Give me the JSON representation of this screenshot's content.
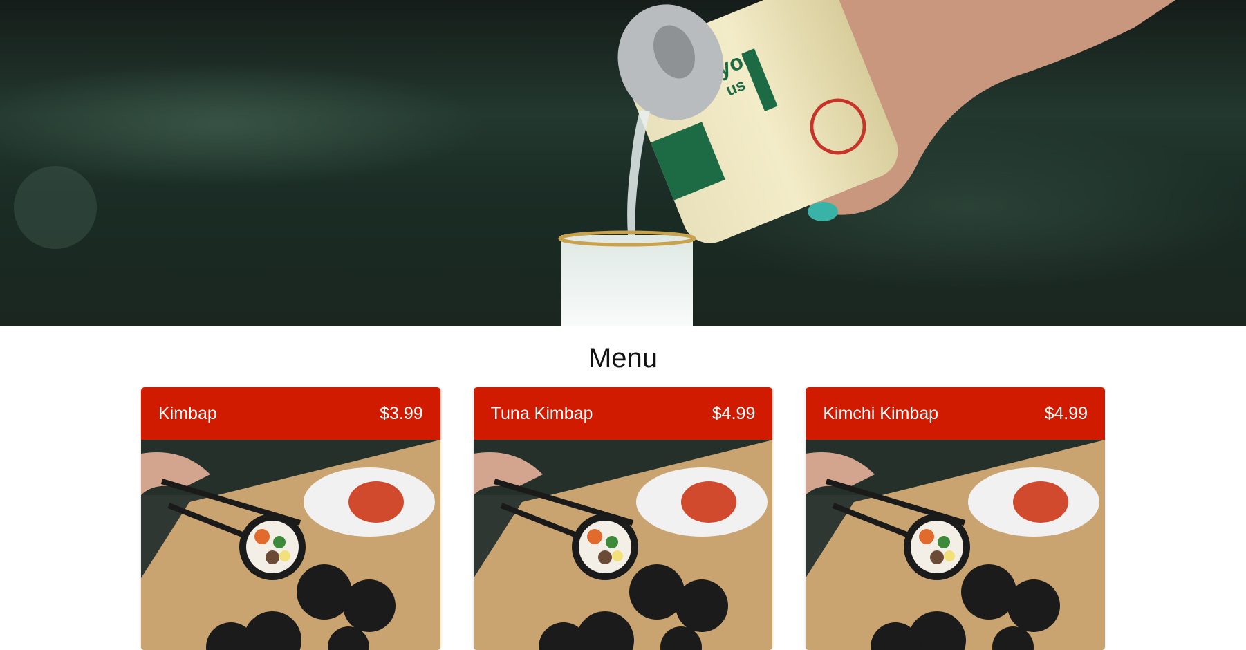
{
  "hero": {
    "image": "soju-pouring-photo",
    "can_text": [
      "you",
      "us"
    ]
  },
  "menu": {
    "title": "Menu",
    "items": [
      {
        "name": "Kimbap",
        "price": "$3.99",
        "image": "kimbap-photo"
      },
      {
        "name": "Tuna Kimbap",
        "price": "$4.99",
        "image": "kimbap-photo"
      },
      {
        "name": "Kimchi Kimbap",
        "price": "$4.99",
        "image": "kimbap-photo"
      }
    ]
  },
  "colors": {
    "card_header": "#d11b00",
    "hero_bg": "#1c2a24"
  }
}
